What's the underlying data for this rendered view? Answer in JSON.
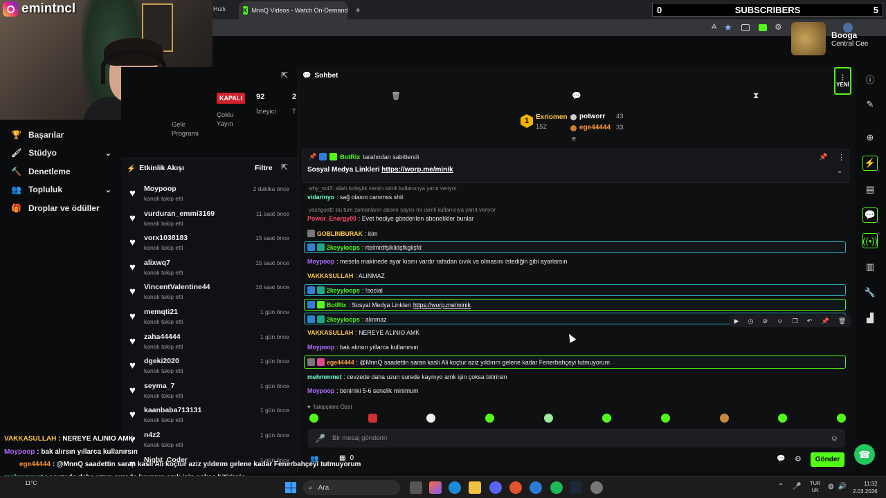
{
  "stream_overlay": {
    "streamer": "emintncl",
    "subscriber_count": "0",
    "subscribers_label": "SUBSCRIBERS",
    "subscriber_goal": "5",
    "now_playing_title": "Booga",
    "now_playing_artist": "Central Cee",
    "overlay_chat": [
      {
        "user": "VAKKASULLAH",
        "text": " : NEREYE ALINIO AMK",
        "color": "#ffc74a"
      },
      {
        "user": "Moypoop",
        "text": " : bak alırsın yıllarca kullanırsın",
        "color": "#b46eff"
      },
      {
        "user": "ege44444",
        "text": " : @MnnQ saadettin saran kaslı Ali koçtur aziz yıldırım gelene kadar Fenerbahçeyi tutmuyorum",
        "color": "#ff9a3c"
      },
      {
        "user": "mehmmmet",
        "text": " : cevzede daha uzun surede kaynıyo amk işin çoksa bitirirsin",
        "color": "#6cffd0"
      },
      {
        "user": "Moypoop",
        "text": " : benimki 5-6 senelik minimum",
        "color": "#b46eff"
      }
    ]
  },
  "browser": {
    "tab_prev": "Hızlı",
    "tab_active": "MnnQ Videos - Watch On-Demand",
    "new_tab": "+"
  },
  "dashboard": {
    "status_badge": "KAPALI",
    "viewers": "92",
    "viewers_label": "İzleyici",
    "other_count": "2",
    "other_label": "T",
    "multistream": "Çoklu Yayın",
    "income_program": "Gelir Programı"
  },
  "sidebar": {
    "items": [
      {
        "label": "Başarılar",
        "icon": "trophy-icon",
        "chevron": false
      },
      {
        "label": "Stüdyo",
        "icon": "brush-icon",
        "chevron": true
      },
      {
        "label": "Denetleme",
        "icon": "hammer-icon",
        "chevron": false
      },
      {
        "label": "Topluluk",
        "icon": "people-icon",
        "chevron": true
      },
      {
        "label": "Droplar ve ödüller",
        "icon": "gift-icon",
        "chevron": false
      }
    ]
  },
  "activity": {
    "title": "Etkinlik Akışı",
    "filter": "Filtre",
    "items": [
      {
        "name": "Moypoop",
        "sub": "kanalı takip etti",
        "time": "2 dakika önce"
      },
      {
        "name": "vurduran_emmi3169",
        "sub": "kanalı takip etti",
        "time": "11 saat önce"
      },
      {
        "name": "vorx1038183",
        "sub": "kanalı takip etti",
        "time": "15 saat önce"
      },
      {
        "name": "alixwq7",
        "sub": "kanalı takip etti",
        "time": "15 saat önce"
      },
      {
        "name": "VincentValentine44",
        "sub": "kanalı takip etti",
        "time": "16 saat önce"
      },
      {
        "name": "memqti21",
        "sub": "kanalı takip etti",
        "time": "1 gün önce"
      },
      {
        "name": "zaha44444",
        "sub": "kanalı takip etti",
        "time": "1 gün önce"
      },
      {
        "name": "dgeki2020",
        "sub": "kanalı takip etti",
        "time": "1 gün önce"
      },
      {
        "name": "seyma_7",
        "sub": "kanalı takip etti",
        "time": "1 gün önce"
      },
      {
        "name": "kaanbaba713131",
        "sub": "kanalı takip etti",
        "time": "1 gün önce"
      },
      {
        "name": "n4z2",
        "sub": "kanalı takip etti",
        "time": "1 gün önce"
      },
      {
        "name": "Night_Coder",
        "sub": "",
        "time": "1 gün önce"
      }
    ]
  },
  "chat": {
    "title": "Sohbet",
    "new_label": "YENİ",
    "leaderboard": {
      "rank": "1",
      "top_user": "Exriomen",
      "top_score": "152",
      "users": [
        {
          "name": "potworr",
          "score": "43"
        },
        {
          "name": "ege44444",
          "score": "33"
        }
      ]
    },
    "pinned": {
      "by_user": "BotRix",
      "by_suffix": "tarafından sabitlendi",
      "text": "Sosyal Medya Linkleri ",
      "link": "https://worp.me/minik"
    },
    "messages": [
      {
        "reply": "why_not3: allah kolaylık versin isimli kullanıcıya yanıt veriyor"
      },
      {
        "user": "vidarinyo",
        "text": ": sağ olasın canımss shit",
        "color": "u-mint"
      },
      {
        "reply": "yasngoatt: bu tum zamanların abone sayısı mı isimli kullanıcıya yanıt veriyor"
      },
      {
        "user": "Power_Energy00",
        "text": ": Evet hediye gönderilen abonelikler bunlar",
        "color": "u-red"
      },
      {
        "user": "GOBLINBURAK",
        "text": ": kim",
        "color": "u-yellow"
      },
      {
        "user": "2keyyloops",
        "text": ": rtelmrdfşiklidşfkgilşfd",
        "color": "u-green"
      },
      {
        "user": "Moypoop",
        "text": ": mesela makinede ayar kısmı vardır rafadan cıvık vs olmasını istediğin gibi ayarlarsın",
        "color": "u-purple"
      },
      {
        "user": "VAKKASULLAH",
        "text": ": ALINMAZ",
        "color": "u-yellow"
      },
      {
        "user": "2keyyloops",
        "text": ": !social",
        "color": "u-green"
      },
      {
        "user": "BotRix",
        "text": ": Sosyal Medya Linkleri ",
        "link": "https://worp.me/minik",
        "color": "u-green"
      },
      {
        "user": "2keyyloops",
        "text": ": alınmaz",
        "color": "u-green"
      },
      {
        "user": "VAKKASULLAH",
        "text": ": NEREYE ALINIO AMK",
        "color": "u-yellow"
      },
      {
        "user": "Moypoop",
        "text": ": bak alırsın yıllarca kullanırsın",
        "color": "u-purple"
      },
      {
        "user": "ege44444",
        "text": ": @MnnQ saadettin saran kaslı Ali koçtur aziz yıldırım gelene kadar Fenerbahçeyi tutmuyorum",
        "color": "u-orange"
      },
      {
        "user": "mehmmmet",
        "text": ": cevzede daha uzun surede kaynıyo amk işin çoksa bitirirsin",
        "color": "u-mint"
      },
      {
        "user": "Moypoop",
        "text": ": benimki 5-6 senelik minimum",
        "color": "u-purple"
      }
    ],
    "followers_only": "Takipçilere Özel",
    "input_placeholder": "Bir mesaj gönderin",
    "viewer_icons": "0",
    "send_button": "Gönder"
  },
  "taskbar": {
    "search": "Ara",
    "weather_temp": "11°C",
    "lang_top": "TUR",
    "lang_bottom": "UK",
    "time": "11:32",
    "date": "2.03.2026"
  },
  "colors": {
    "kick_green": "#53fc18",
    "live_red": "#d0202b",
    "cyan_border": "#2fb3c6"
  }
}
